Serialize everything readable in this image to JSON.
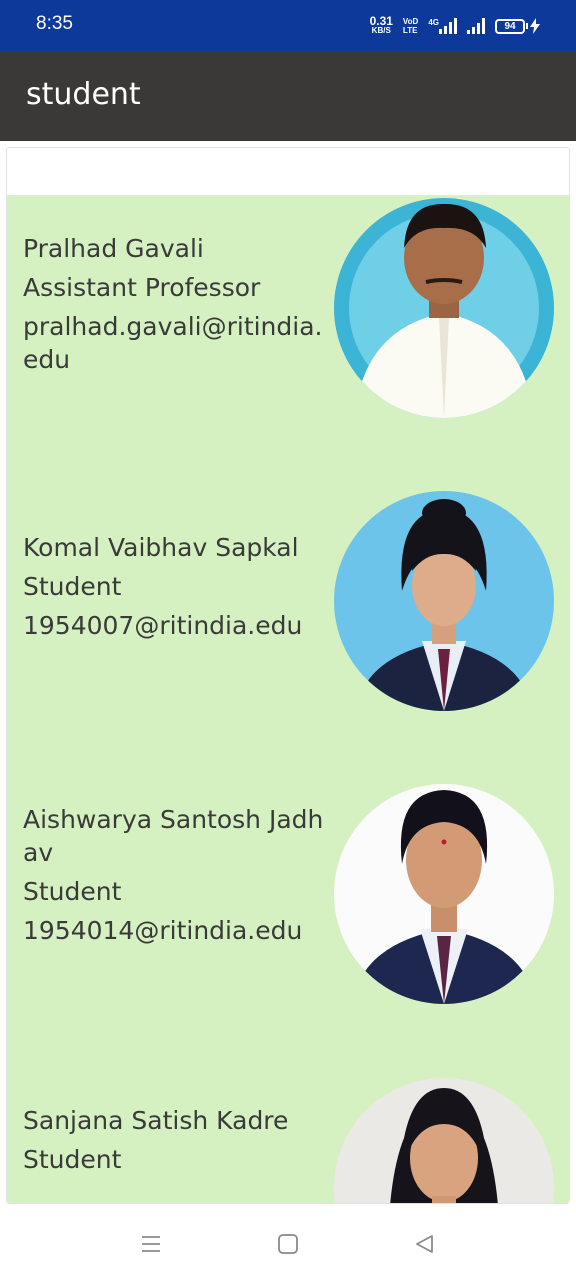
{
  "status_bar": {
    "time": "8:35",
    "net_speed_value": "0.31",
    "net_speed_unit": "KB/S",
    "volte_top": "VoD",
    "volte_bottom": "LTE",
    "network_type": "4G",
    "battery_level": "94"
  },
  "app_bar": {
    "title": "student"
  },
  "people": [
    {
      "name": "Pralhad Gavali",
      "role": "Assistant Professor",
      "email": "pralhad.gavali@ritindia.edu"
    },
    {
      "name": "Komal Vaibhav Sapkal",
      "role": "Student",
      "email": "1954007@ritindia.edu"
    },
    {
      "name": "Aishwarya Santosh Jadhav",
      "role": "Student",
      "email": "1954014@ritindia.edu"
    },
    {
      "name": "Sanjana Satish Kadre",
      "role": "Student",
      "email": ""
    }
  ],
  "colors": {
    "status_bar": "#0d3a9a",
    "app_bar": "#3b3938",
    "list_background": "#d5f0c1",
    "text": "#3a3a3a"
  }
}
